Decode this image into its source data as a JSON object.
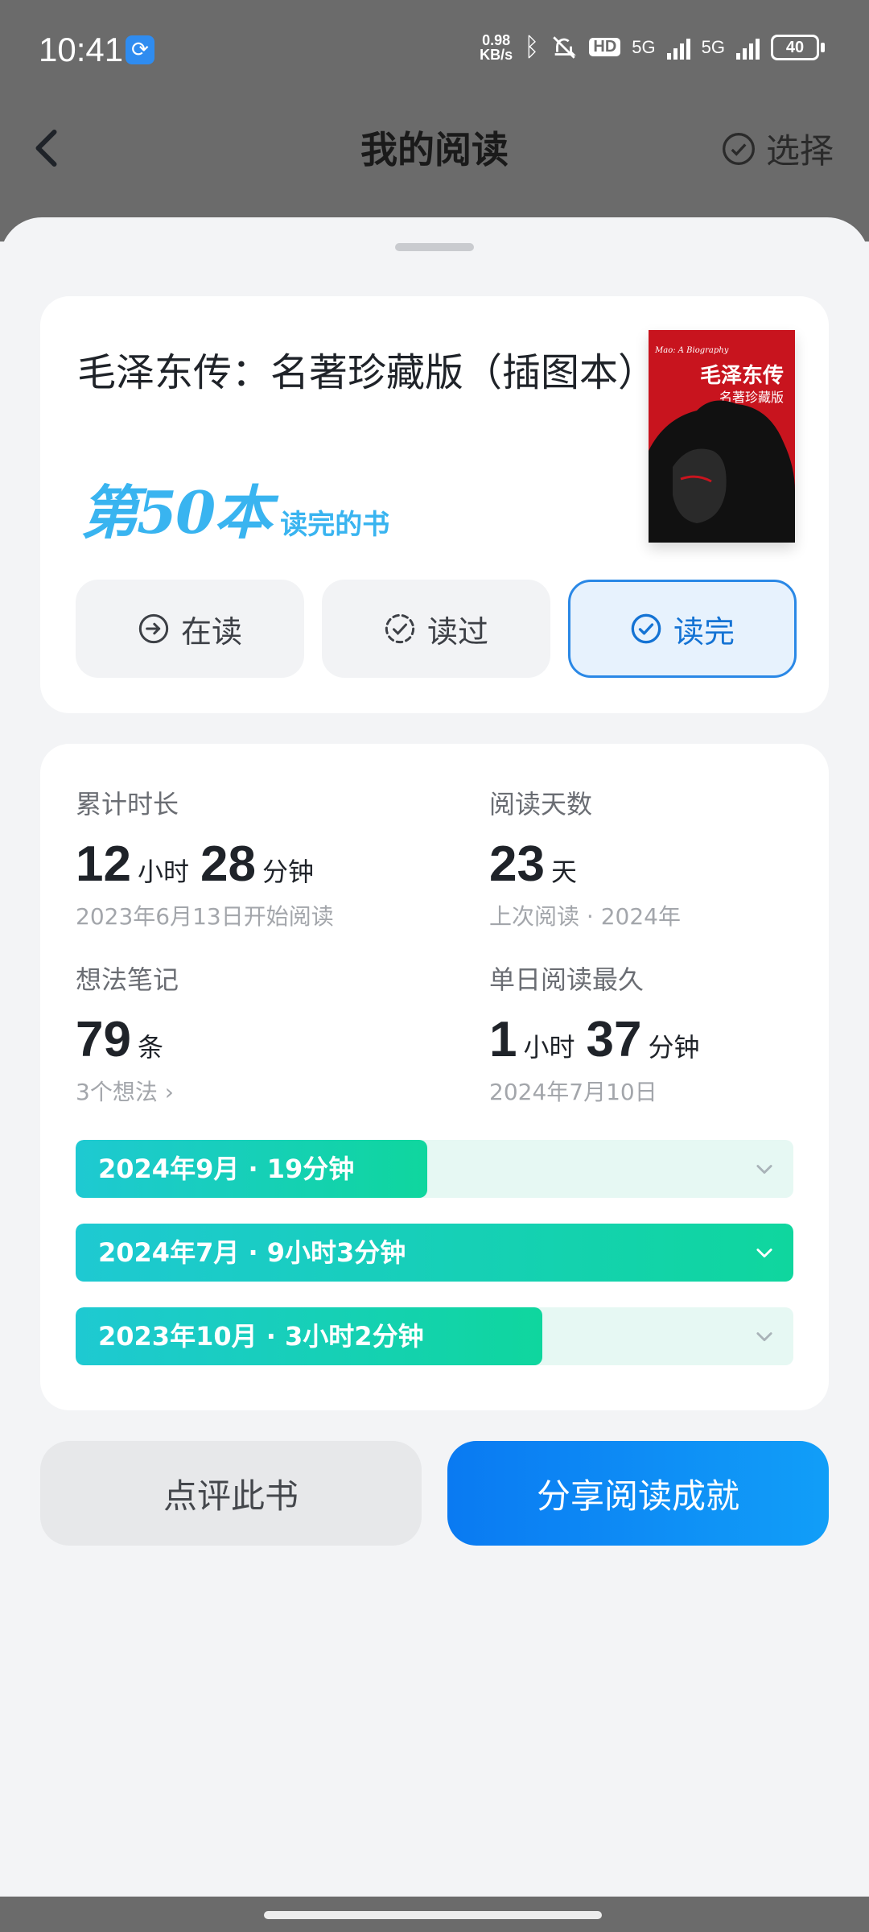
{
  "status_bar": {
    "time": "10:41",
    "net_speed_value": "0.98",
    "net_speed_unit": "KB/s",
    "hd": "HD",
    "sim1": "5G",
    "sim2": "5G",
    "battery": "40"
  },
  "nav": {
    "title": "我的阅读",
    "select_label": "选择"
  },
  "book": {
    "title": "毛泽东传：名著珍藏版（插图本）",
    "rank_big": "第50本",
    "rank_small": "读完的书",
    "cover": {
      "title": "毛泽东传",
      "subtitle": "名著珍藏版",
      "english": "Mao: A Biography",
      "color": "#c8141e"
    }
  },
  "status_buttons": [
    {
      "label": "在读",
      "icon": "arrow-right-circle-icon",
      "active": false
    },
    {
      "label": "读过",
      "icon": "dashed-check-circle-icon",
      "active": false
    },
    {
      "label": "读完",
      "icon": "check-circle-icon",
      "active": true
    }
  ],
  "stats": {
    "total_time": {
      "label": "累计时长",
      "hours": "12",
      "hours_unit": "小时",
      "minutes": "28",
      "minutes_unit": "分钟",
      "sub": "2023年6月13日开始阅读"
    },
    "reading_days": {
      "label": "阅读天数",
      "value": "23",
      "unit": "天",
      "sub": "上次阅读 · 2024年"
    },
    "notes": {
      "label": "想法笔记",
      "value": "79",
      "unit": "条",
      "sub": "3个想法"
    },
    "longest_day": {
      "label": "单日阅读最久",
      "hours": "1",
      "hours_unit": "小时",
      "minutes": "37",
      "minutes_unit": "分钟",
      "sub": "2024年7月10日"
    }
  },
  "monthly": [
    {
      "label": "2024年9月 · 19分钟",
      "fill_fraction": 0.49
    },
    {
      "label": "2024年7月 · 9小时3分钟",
      "fill_fraction": 1.0
    },
    {
      "label": "2023年10月 · 3小时2分钟",
      "fill_fraction": 0.65
    }
  ],
  "actions": {
    "review": "点评此书",
    "share": "分享阅读成就"
  },
  "colors": {
    "accent_blue": "#2a88e6",
    "bar_gradient_start": "#1ec9d2",
    "bar_gradient_end": "#0fd69e",
    "rank_color": "#39b4f0"
  }
}
